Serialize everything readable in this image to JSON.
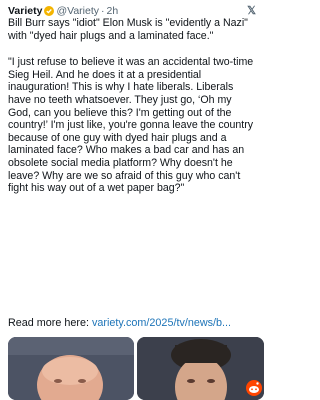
{
  "post": {
    "author": "Variety",
    "handle": "@Variety",
    "separator": "·",
    "time": "2h",
    "headline": "Bill Burr says \"idiot\" Elon Musk is \"evidently a Nazi\" with \"dyed hair plugs and a laminated face.\"",
    "quote": "\"I just refuse to believe it was an accidental two-time Sieg Heil. And he does it at a presidential inauguration! This is why I hate liberals. Liberals have no teeth whatsoever. They just go, ‘Oh my God, can you believe this? I'm getting out of the country!’ I'm just like, you're gonna leave the country because of one guy with dyed hair plugs and a laminated face? Who makes a bad car and has an obsolete social media platform? Why doesn't he leave? Why are we so afraid of this guy who can't fight his way out of a wet paper bag?\"",
    "read_more_label": "Read more here:",
    "read_more_link": "variety.com/2025/tv/news/b..."
  },
  "colors": {
    "verified": "#f4b400",
    "link": "#1d74b8",
    "handle": "#536471",
    "reddit_badge": "#ff4500"
  },
  "icons": {
    "verified": "verified-badge-icon",
    "platform": "x-logo-icon",
    "badge": "reddit-snoo-icon"
  }
}
